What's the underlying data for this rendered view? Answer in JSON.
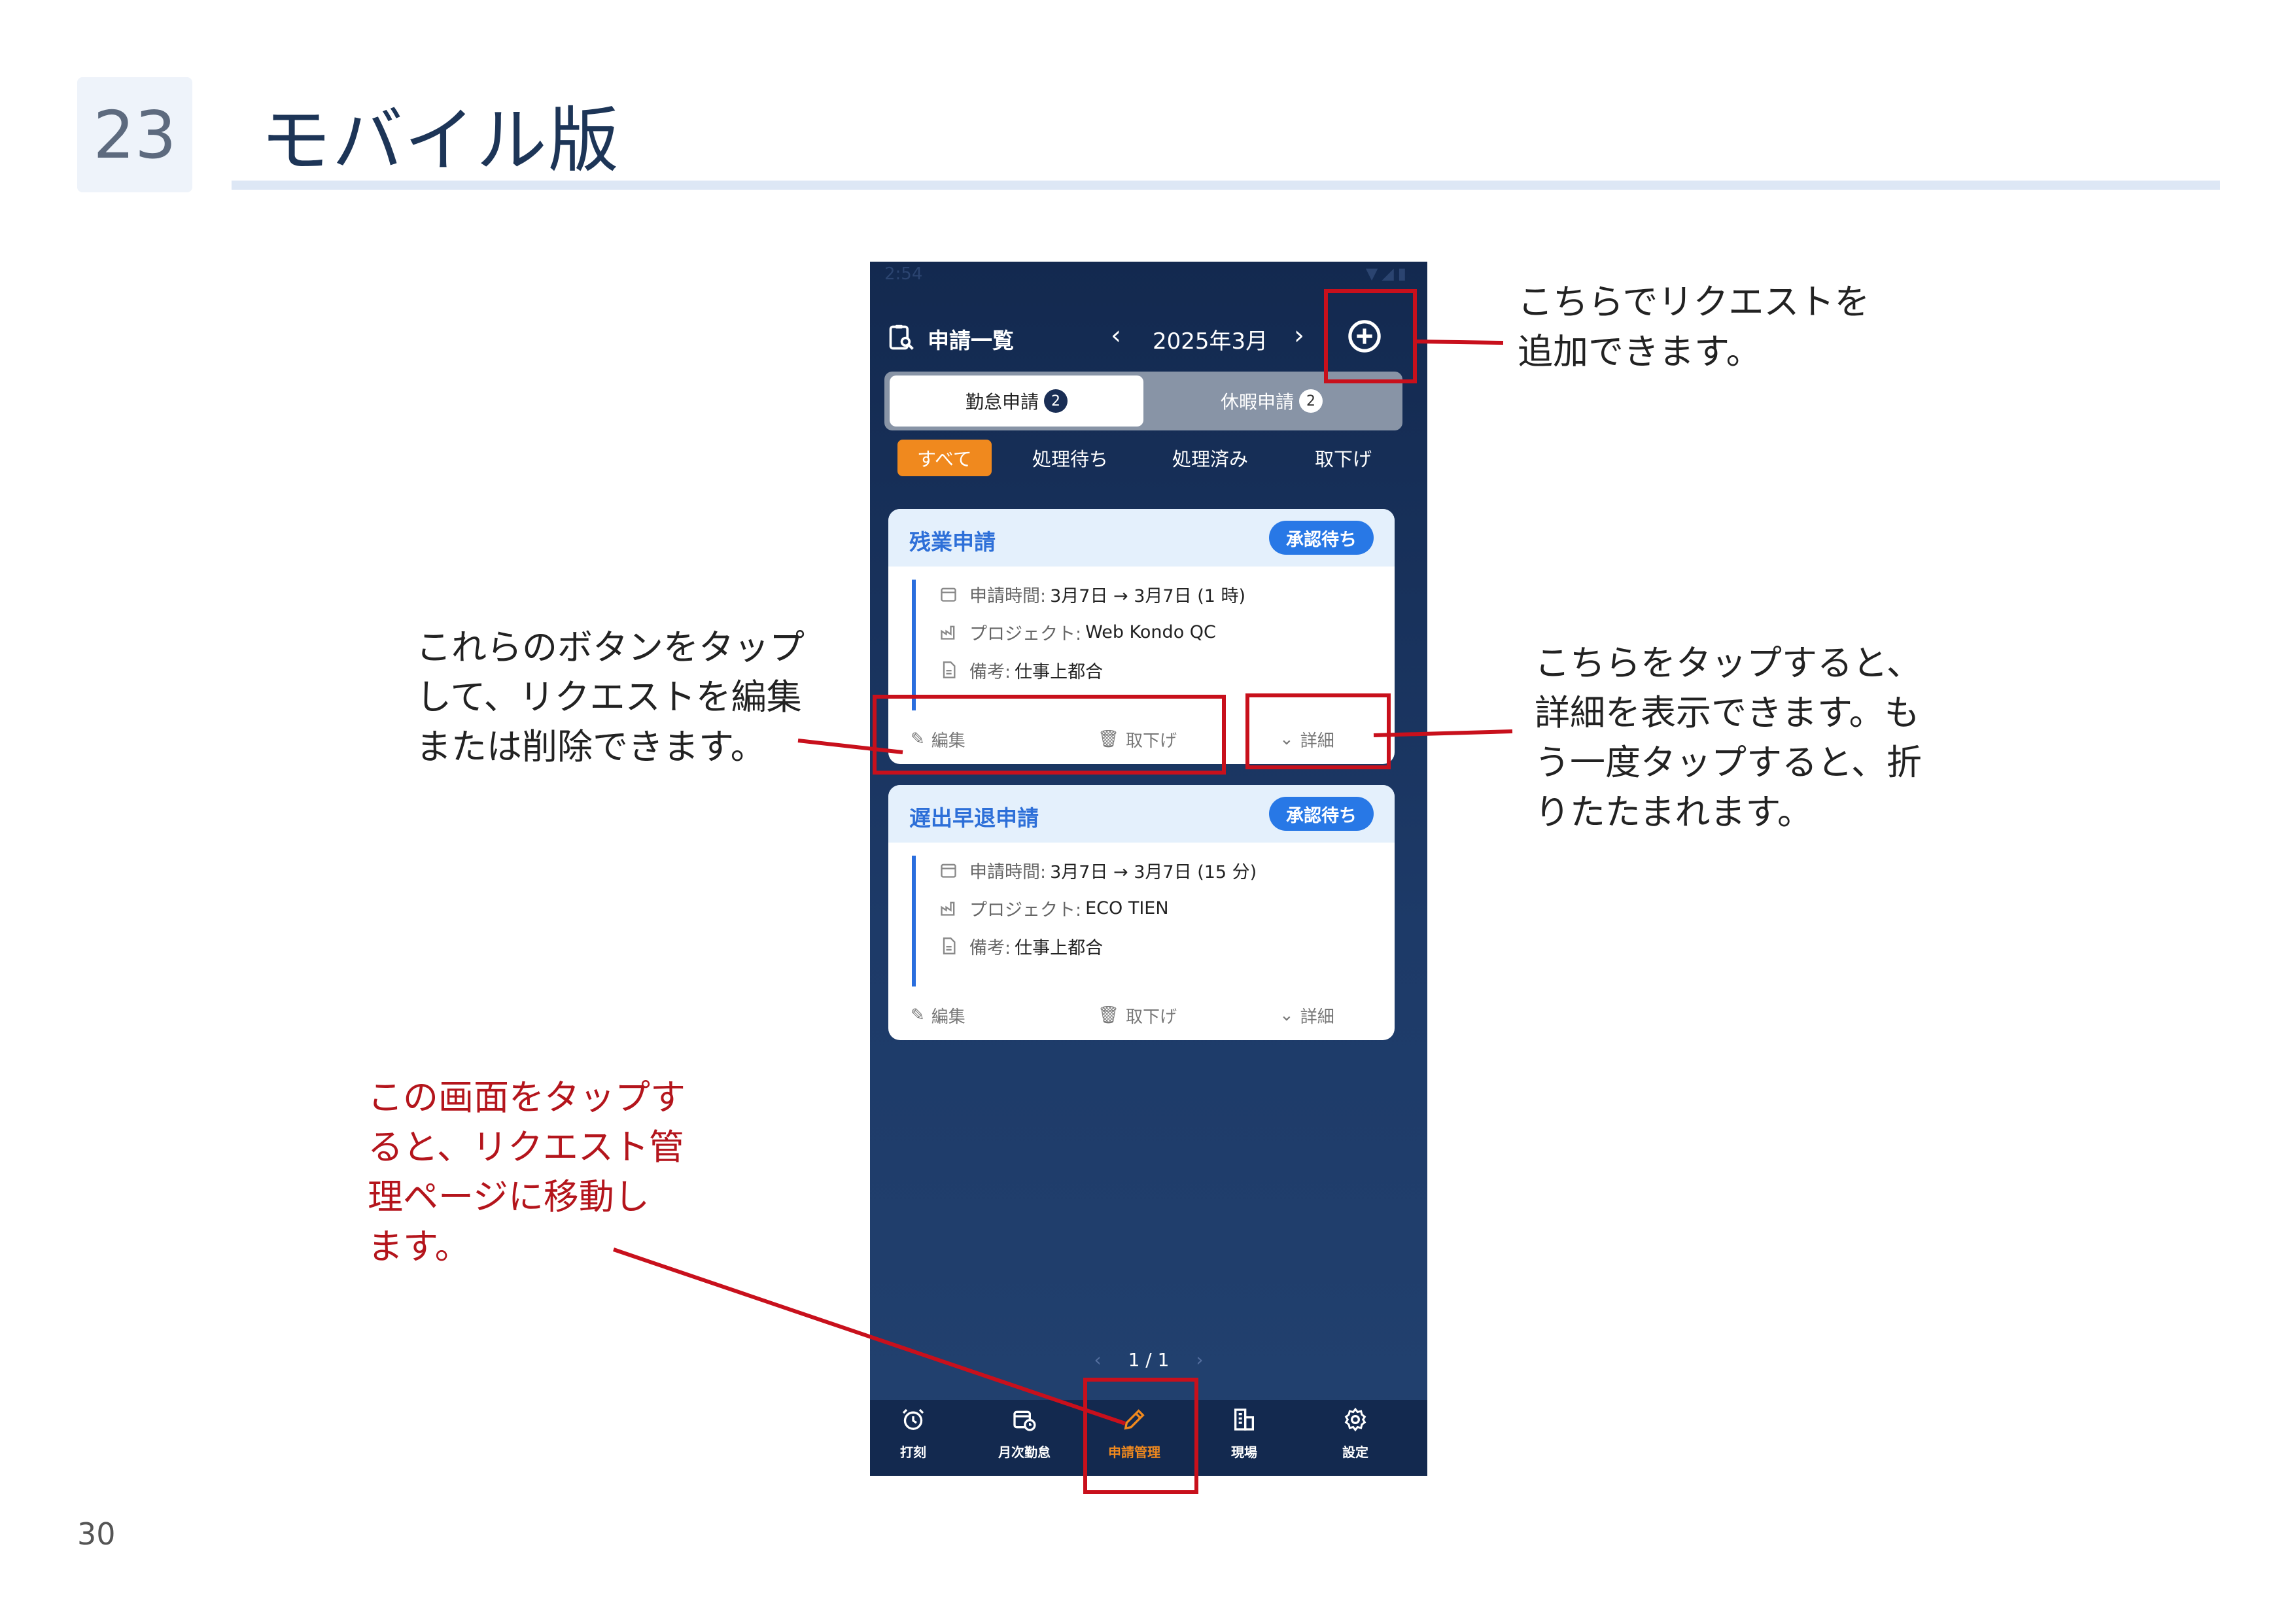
{
  "slide": {
    "number": "23",
    "title": "モバイル版",
    "page_number": "30"
  },
  "phone": {
    "status_bar": {
      "time": "2:54",
      "icons": "▼◢▮"
    },
    "app_bar": {
      "title": "申請一覧",
      "prev_label": "‹",
      "month": "2025年3月",
      "next_label": "›"
    },
    "type_tabs": [
      {
        "label": "勤怠申請",
        "count": "2"
      },
      {
        "label": "休暇申請",
        "count": "2"
      }
    ],
    "filters": [
      "すべて",
      "処理待ち",
      "処理済み",
      "取下げ"
    ],
    "requests": [
      {
        "title": "残業申請",
        "status": "承認待ち",
        "time_label": "申請時間:",
        "time_value": "3月7日 → 3月7日 (1 時)",
        "project_label": "プロジェクト:",
        "project_value": "Web Kondo QC",
        "note_label": "備考:",
        "note_value": "仕事上都合",
        "edit": "編集",
        "withdraw": "取下げ",
        "detail": "詳細"
      },
      {
        "title": "遅出早退申請",
        "status": "承認待ち",
        "time_label": "申請時間:",
        "time_value": "3月7日 → 3月7日 (15 分)",
        "project_label": "プロジェクト:",
        "project_value": "ECO TIEN",
        "note_label": "備考:",
        "note_value": "仕事上都合",
        "edit": "編集",
        "withdraw": "取下げ",
        "detail": "詳細"
      }
    ],
    "pager": {
      "prev": "‹",
      "text": "1 / 1",
      "next": "›"
    },
    "bottom_nav": [
      {
        "label": "打刻",
        "icon": "alarm-clock-icon"
      },
      {
        "label": "月次勤怠",
        "icon": "calendar-clock-icon"
      },
      {
        "label": "申請管理",
        "icon": "pencil-icon",
        "active": true
      },
      {
        "label": "現場",
        "icon": "building-icon"
      },
      {
        "label": "設定",
        "icon": "gear-icon"
      }
    ],
    "accent_color": "#f0891e",
    "primary_color": "#2878e6"
  },
  "annotations": {
    "add_note": [
      "こちらでリクエストを",
      "追加できます。"
    ],
    "edit_note": [
      "これらのボタンをタップ",
      "して、リクエストを編集",
      "または削除できます。"
    ],
    "detail_note": [
      "こちらをタップすると、",
      "詳細を表示できます。も",
      "う一度タップすると、折",
      "りたたまれます。"
    ],
    "nav_note": [
      "この画面をタップす",
      "ると、リクエスト管",
      "理ページに移動し",
      "ます。"
    ],
    "highlight_color": "#c8101c"
  }
}
